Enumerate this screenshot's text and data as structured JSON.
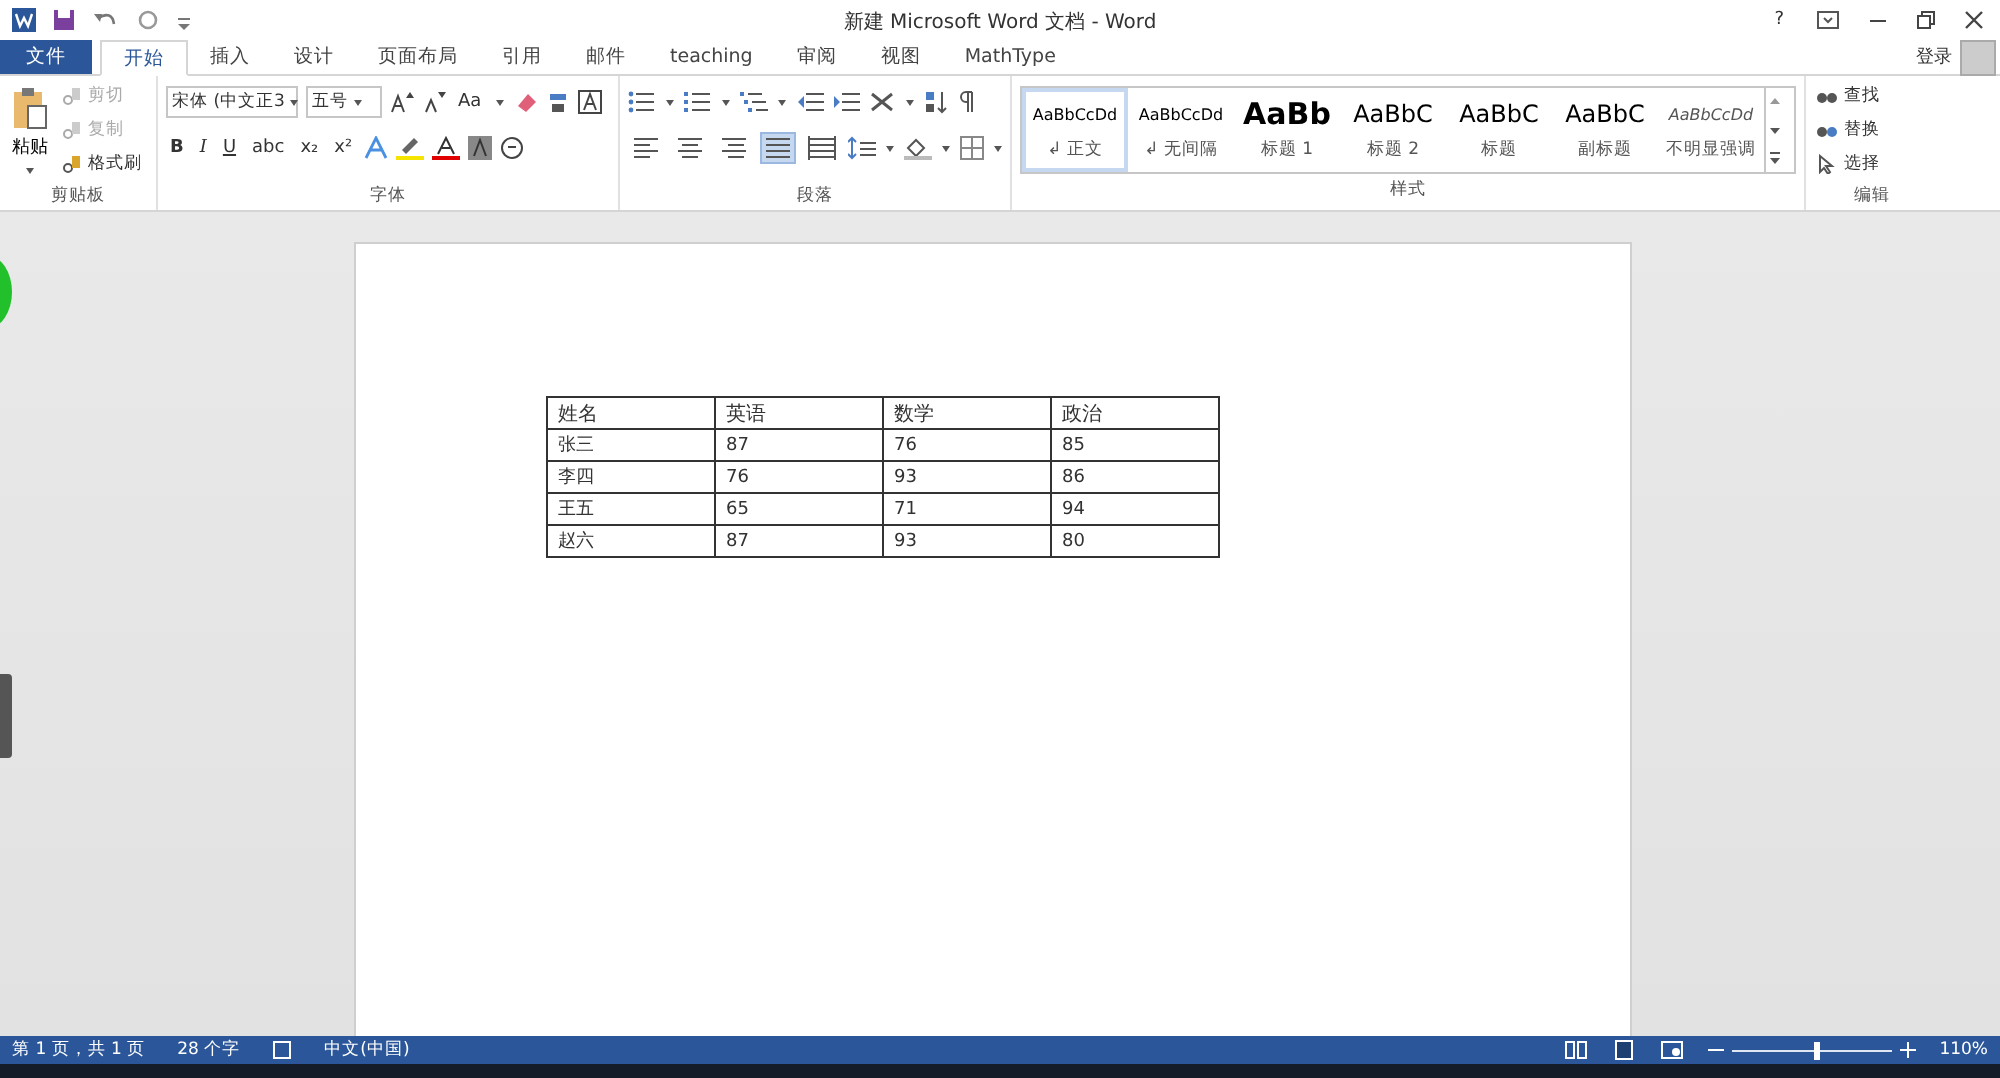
{
  "window": {
    "title": "新建 Microsoft Word 文档 - Word",
    "help": "?",
    "login": "登录"
  },
  "tabs": [
    {
      "label": "文件",
      "kind": "file",
      "selected": false
    },
    {
      "label": "开始",
      "kind": "tab",
      "selected": true
    },
    {
      "label": "插入",
      "kind": "tab",
      "selected": false
    },
    {
      "label": "设计",
      "kind": "tab",
      "selected": false
    },
    {
      "label": "页面布局",
      "kind": "tab",
      "selected": false
    },
    {
      "label": "引用",
      "kind": "tab",
      "selected": false
    },
    {
      "label": "邮件",
      "kind": "tab",
      "selected": false
    },
    {
      "label": "teaching",
      "kind": "tab",
      "selected": false
    },
    {
      "label": "审阅",
      "kind": "tab",
      "selected": false
    },
    {
      "label": "视图",
      "kind": "tab",
      "selected": false
    },
    {
      "label": "MathType",
      "kind": "tab",
      "selected": false
    }
  ],
  "clipboard": {
    "label": "剪贴板",
    "paste": "粘贴",
    "actions": [
      {
        "label": "剪切",
        "disabled": true
      },
      {
        "label": "复制",
        "disabled": true
      },
      {
        "label": "格式刷",
        "disabled": false
      }
    ]
  },
  "font": {
    "label": "字体",
    "name": "宋体 (中文正3",
    "size": "五号",
    "case_button": "Aa",
    "format_buttons": [
      "B",
      "I",
      "U",
      "abc",
      "x₂",
      "x²"
    ]
  },
  "paragraph": {
    "label": "段落",
    "alignments": [
      {
        "selected": false
      },
      {
        "selected": false
      },
      {
        "selected": false
      },
      {
        "selected": true
      },
      {
        "selected": false
      }
    ]
  },
  "styles": {
    "label": "样式",
    "items": [
      {
        "sample": "AaBbCcDd",
        "name": "↲ 正文",
        "kind": "small",
        "selected": true
      },
      {
        "sample": "AaBbCcDd",
        "name": "↲ 无间隔",
        "kind": "small",
        "selected": false
      },
      {
        "sample": "AaBb",
        "name": "标题 1",
        "kind": "heading",
        "selected": false
      },
      {
        "sample": "AaBbC",
        "name": "标题 2",
        "kind": "large",
        "selected": false
      },
      {
        "sample": "AaBbC",
        "name": "标题",
        "kind": "large",
        "selected": false
      },
      {
        "sample": "AaBbC",
        "name": "副标题",
        "kind": "large",
        "selected": false
      },
      {
        "sample": "AaBbCcDd",
        "name": "不明显强调",
        "kind": "italic",
        "selected": false
      }
    ]
  },
  "editing": {
    "label": "编辑",
    "actions": [
      "查找",
      "替换",
      "选择"
    ]
  },
  "table": {
    "rows": [
      [
        "姓名",
        "英语",
        "数学",
        "政治"
      ],
      [
        "张三",
        "87",
        "76",
        "85"
      ],
      [
        "李四",
        "76",
        "93",
        "86"
      ],
      [
        "王五",
        "65",
        "71",
        "94"
      ],
      [
        "赵六",
        "87",
        "93",
        "80"
      ]
    ]
  },
  "status_bar": {
    "page": "第 1 页，共 1 页",
    "words": "28 个字",
    "language": "中文(中国)",
    "zoom": "110%",
    "zoom_slider": {
      "level": 0.53
    }
  }
}
